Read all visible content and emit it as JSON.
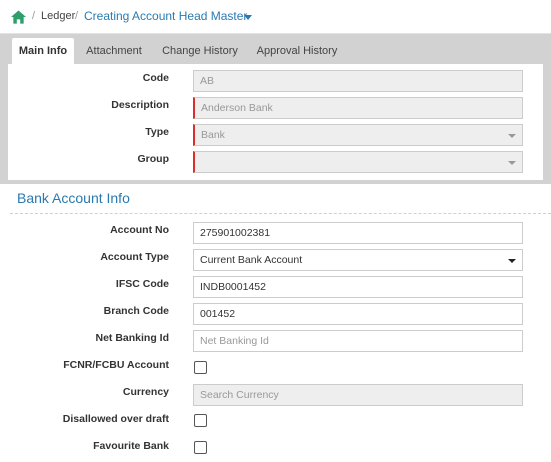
{
  "breadcrumb": {
    "home_icon": "home-icon",
    "sep": "/",
    "ledger": "Ledger",
    "current": "Creating Account Head Master"
  },
  "tabs": [
    {
      "label": "Main Info",
      "active": true
    },
    {
      "label": "Attachment",
      "active": false
    },
    {
      "label": "Change History",
      "active": false
    },
    {
      "label": "Approval History",
      "active": false
    }
  ],
  "main_info": {
    "code": {
      "label": "Code",
      "value": "AB"
    },
    "description": {
      "label": "Description",
      "value": "Anderson Bank"
    },
    "type": {
      "label": "Type",
      "value": "Bank"
    },
    "group": {
      "label": "Group",
      "value": ""
    }
  },
  "bank_info": {
    "title": "Bank Account Info",
    "account_no": {
      "label": "Account No",
      "value": "275901002381"
    },
    "account_type": {
      "label": "Account Type",
      "value": "Current Bank Account"
    },
    "ifsc": {
      "label": "IFSC Code",
      "value": "INDB0001452"
    },
    "branch": {
      "label": "Branch Code",
      "value": "001452"
    },
    "net_banking": {
      "label": "Net Banking Id",
      "placeholder": "Net Banking Id"
    },
    "fcnr": {
      "label": "FCNR/FCBU Account",
      "checked": false
    },
    "currency": {
      "label": "Currency",
      "placeholder": "Search Currency"
    },
    "overdraft": {
      "label": "Disallowed over draft",
      "checked": false
    },
    "favourite": {
      "label": "Favourite Bank",
      "checked": false
    }
  },
  "colors": {
    "accent": "#2a7ab0",
    "required": "#d9302c",
    "home_icon": "#2e9e6a",
    "tab_bar": "#d2d2d2"
  }
}
